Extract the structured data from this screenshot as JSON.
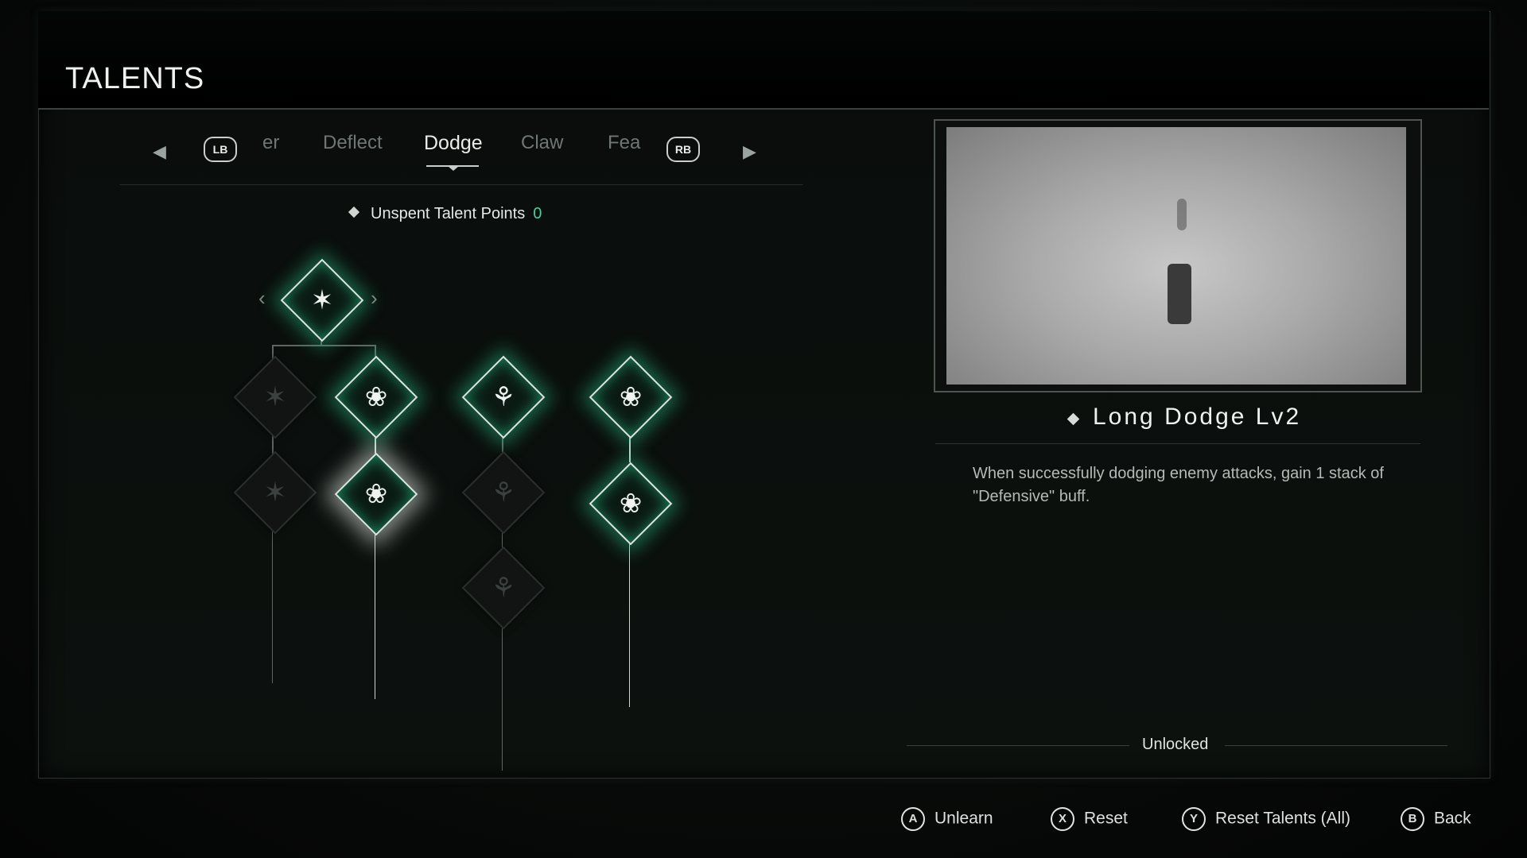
{
  "header": {
    "title": "TALENTS"
  },
  "tabs": {
    "left_button": "LB",
    "right_button": "RB",
    "items": [
      "er",
      "Deflect",
      "Dodge",
      "Claw",
      "Fea"
    ],
    "active": "Dodge"
  },
  "talent_points": {
    "label": "Unspent Talent Points",
    "value": "0"
  },
  "tree": {
    "nodes": [
      {
        "id": "root",
        "icon": "dodge-sprint-icon",
        "state": "unlocked"
      },
      {
        "id": "c1r1",
        "icon": "dash-icon",
        "state": "locked"
      },
      {
        "id": "c2r1",
        "icon": "dodge-slide-icon",
        "state": "unlocked"
      },
      {
        "id": "c3r1",
        "icon": "guard-icon",
        "state": "unlocked"
      },
      {
        "id": "c4r1",
        "icon": "spin-dodge-icon",
        "state": "unlocked"
      },
      {
        "id": "c1r2",
        "icon": "dash-icon",
        "state": "locked"
      },
      {
        "id": "c2r2",
        "icon": "long-dodge-icon",
        "state": "selected"
      },
      {
        "id": "c3r2",
        "icon": "guard-icon",
        "state": "locked"
      },
      {
        "id": "c4r2",
        "icon": "spin-dodge-icon",
        "state": "unlocked"
      },
      {
        "id": "c3r3",
        "icon": "guard-icon",
        "state": "locked"
      }
    ]
  },
  "detail": {
    "title": "Long Dodge Lv2",
    "description": "When successfully dodging enemy attacks, gain 1 stack of \"Defensive\" buff.",
    "status": "Unlocked"
  },
  "footer": {
    "unlearn": {
      "button": "A",
      "label": "Unlearn"
    },
    "reset": {
      "button": "X",
      "label": "Reset"
    },
    "reset_all": {
      "button": "Y",
      "label": "Reset Talents (All)"
    },
    "back": {
      "button": "B",
      "label": "Back"
    }
  },
  "colors": {
    "accent": "#3fd49a",
    "glow": "#28c88c"
  }
}
